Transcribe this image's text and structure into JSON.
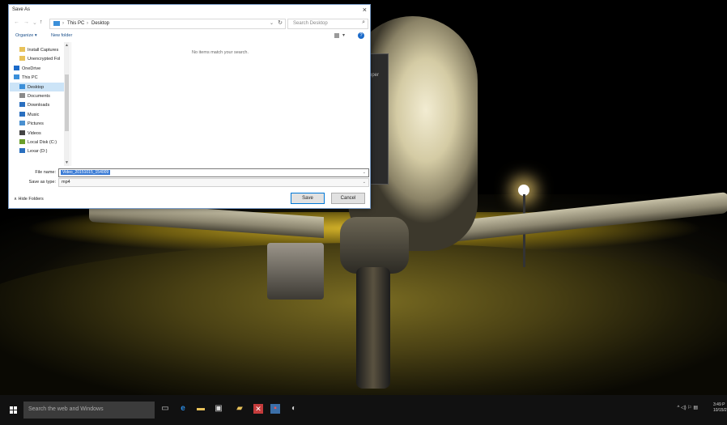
{
  "dialog": {
    "title": "Save As",
    "close_glyph": "×",
    "breadcrumb": [
      "This PC",
      "Desktop"
    ],
    "search_placeholder": "Search Desktop",
    "toolbar": {
      "organize": "Organize ▾",
      "new_folder": "New folder",
      "help": "?"
    },
    "nav_items": [
      {
        "label": "Install Captures",
        "icon": "folder-icon",
        "color": "#e8c25a",
        "selected": false
      },
      {
        "label": "Unencrypted Fol",
        "icon": "folder-icon",
        "color": "#e8c25a",
        "selected": false
      },
      {
        "label": "OneDrive",
        "icon": "onedrive-icon",
        "color": "#1b6ac9",
        "selected": false
      },
      {
        "label": "This PC",
        "icon": "pc-icon",
        "color": "#3b8fd9",
        "selected": false
      },
      {
        "label": "Desktop",
        "icon": "desktop-icon",
        "color": "#3b8fd9",
        "selected": true
      },
      {
        "label": "Documents",
        "icon": "documents-icon",
        "color": "#8a8a8a",
        "selected": false
      },
      {
        "label": "Downloads",
        "icon": "downloads-icon",
        "color": "#2a6fbf",
        "selected": false
      },
      {
        "label": "Music",
        "icon": "music-icon",
        "color": "#2a6fbf",
        "selected": false
      },
      {
        "label": "Pictures",
        "icon": "pictures-icon",
        "color": "#4a90d0",
        "selected": false
      },
      {
        "label": "Videos",
        "icon": "videos-icon",
        "color": "#444",
        "selected": false
      },
      {
        "label": "Local Disk (C:)",
        "icon": "disk-icon",
        "color": "#6a9e2a",
        "selected": false
      },
      {
        "label": "Lexar (D:)",
        "icon": "usb-drive-icon",
        "color": "#2a6fbf",
        "selected": false
      }
    ],
    "empty_message": "No items match your search.",
    "file_name_label": "File name:",
    "file_name_value": "Video_20151015_154009",
    "save_type_label": "Save as type:",
    "save_type_value": "mp4",
    "hide_folders": "∧ Hide Folders",
    "save_button": "Save",
    "cancel_button": "Cancel"
  },
  "background_window_label": "pper",
  "taskbar": {
    "search_placeholder": "Search the web and Windows",
    "tray_time": "3:49 P",
    "tray_date": "10/15/2"
  }
}
